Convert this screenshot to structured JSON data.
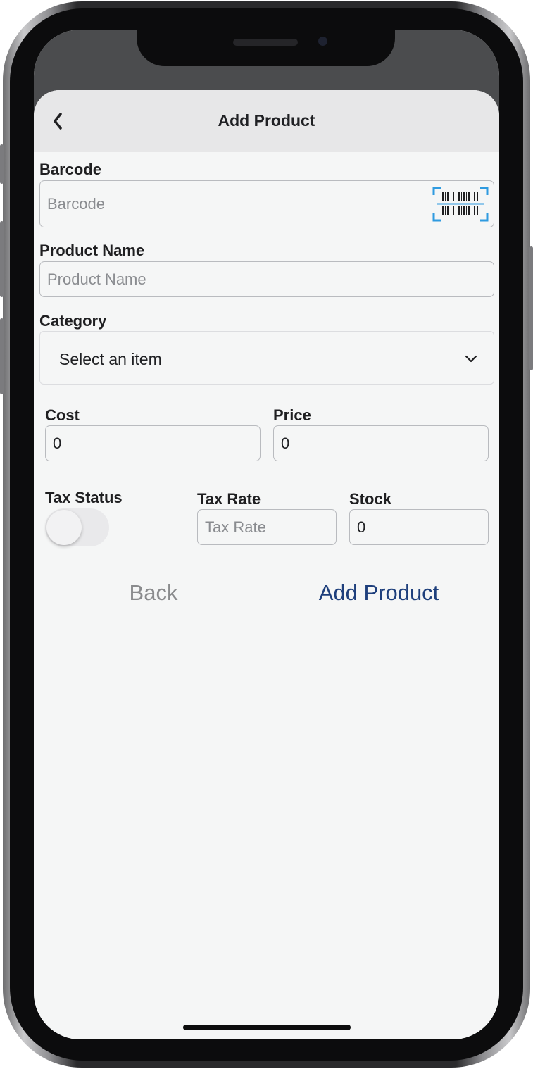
{
  "header": {
    "title": "Add Product"
  },
  "barcode": {
    "label": "Barcode",
    "placeholder": "Barcode",
    "value": ""
  },
  "product_name": {
    "label": "Product Name",
    "placeholder": "Product Name",
    "value": ""
  },
  "category": {
    "label": "Category",
    "selected": "Select an item"
  },
  "cost": {
    "label": "Cost",
    "value": "0"
  },
  "price": {
    "label": "Price",
    "value": "0"
  },
  "tax_status": {
    "label": "Tax Status",
    "enabled": false
  },
  "tax_rate": {
    "label": "Tax Rate",
    "placeholder": "Tax Rate",
    "value": ""
  },
  "stock": {
    "label": "Stock",
    "value": "0"
  },
  "actions": {
    "back_label": "Back",
    "add_label": "Add Product"
  },
  "icons": {
    "back": "chevron-left-icon",
    "scan": "barcode-scan-icon",
    "dropdown": "chevron-down-icon"
  },
  "colors": {
    "primary_action": "#1e3f7c",
    "secondary_action": "#8a8b8d",
    "scan_accent": "#2f9be0"
  }
}
